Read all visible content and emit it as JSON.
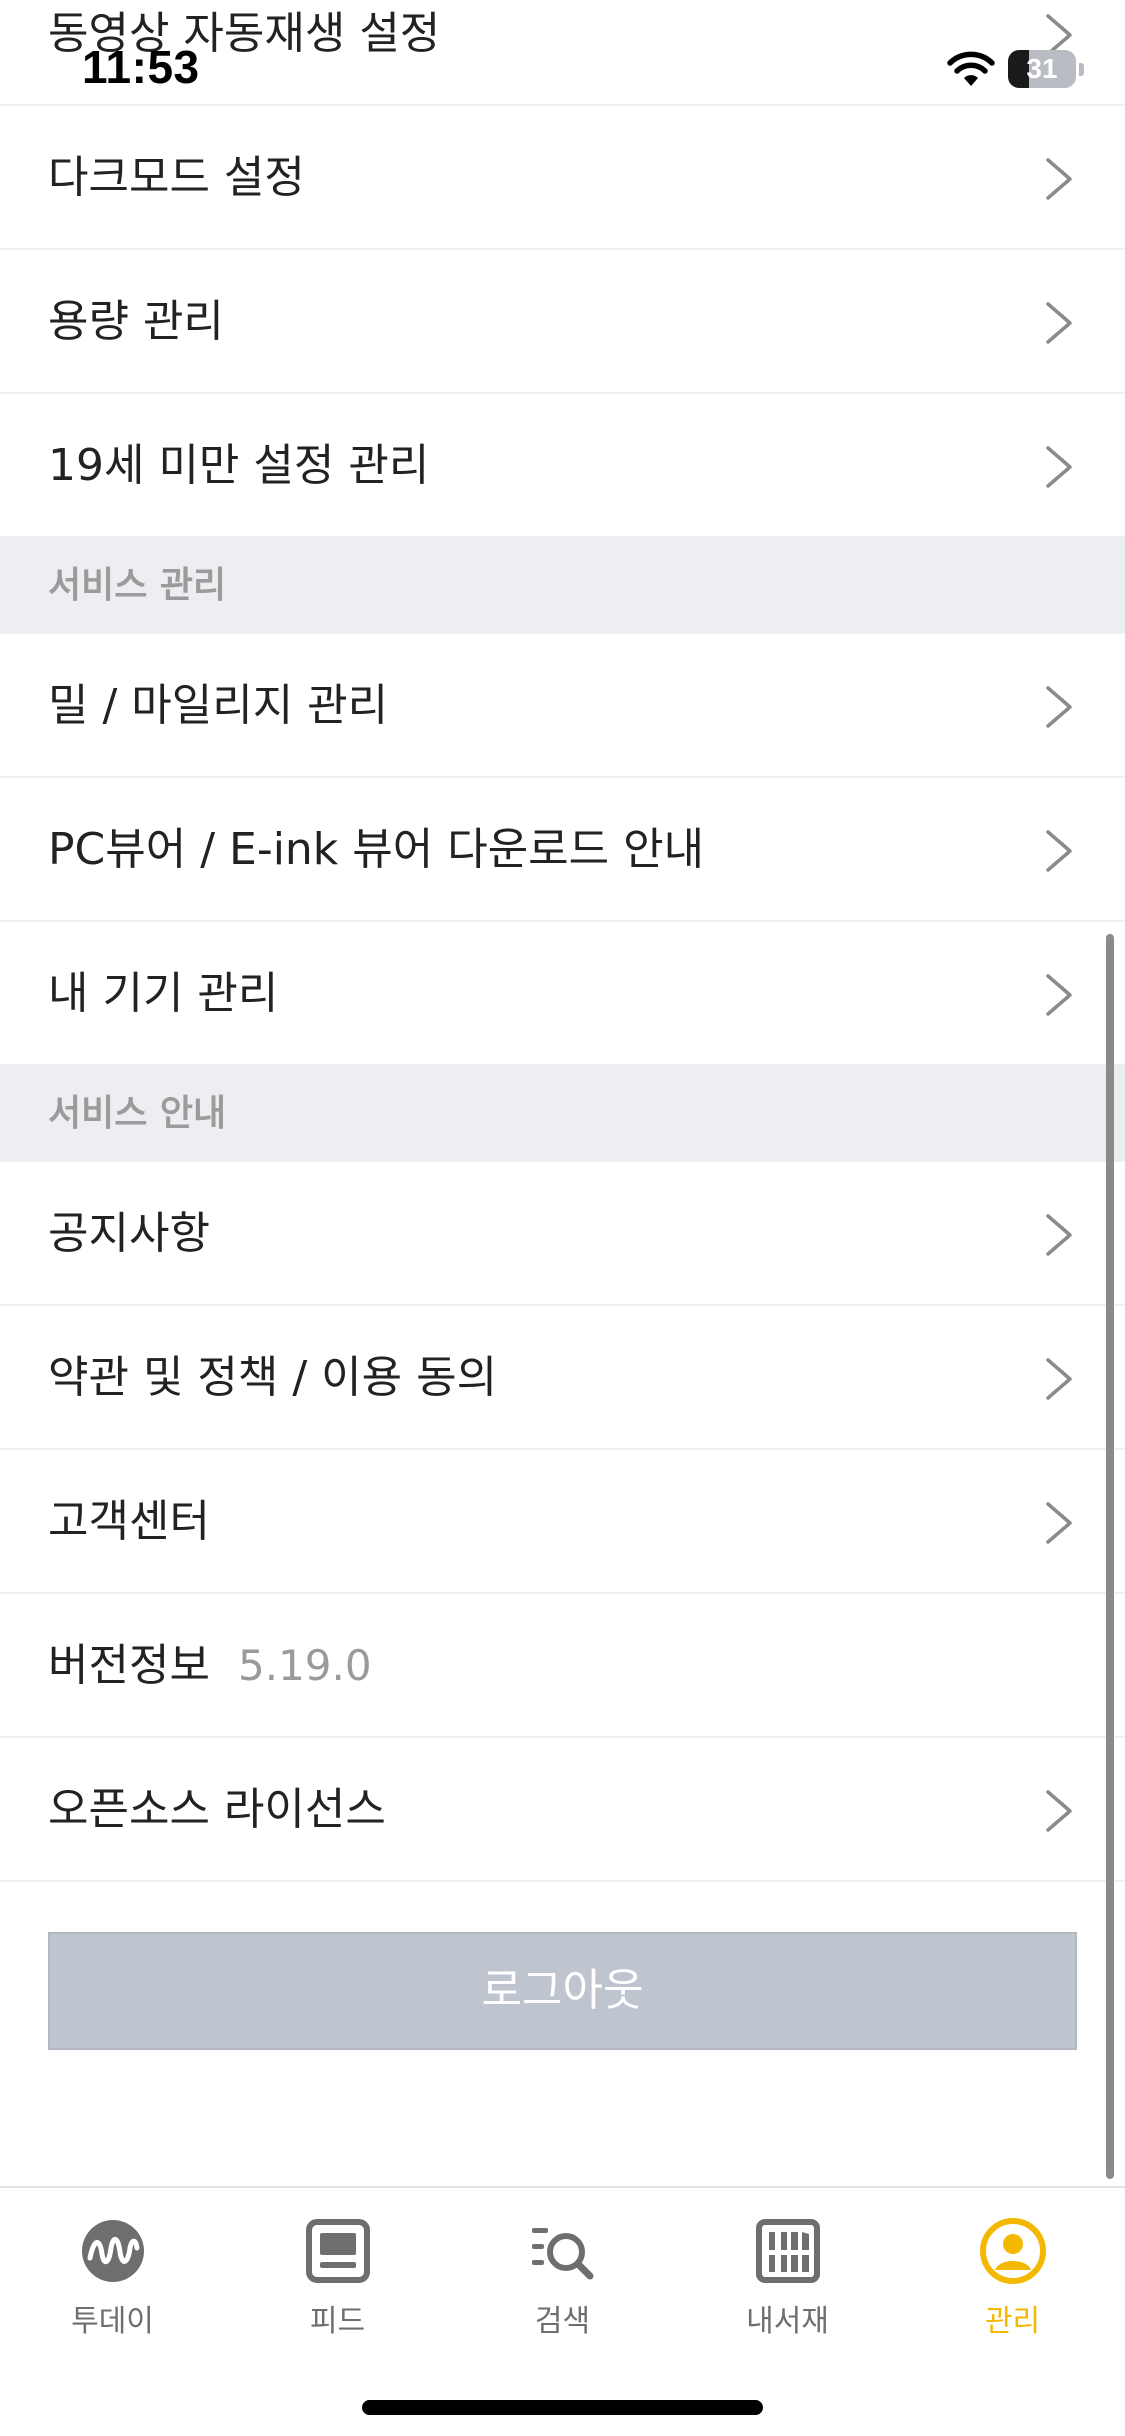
{
  "status_bar": {
    "time": "11:53",
    "battery_level": "31",
    "battery_fraction": 0.31
  },
  "settings": {
    "rows_top": [
      {
        "label": "동영상 자동재생 설정"
      },
      {
        "label": "다크모드 설정"
      },
      {
        "label": "용량 관리"
      },
      {
        "label": "19세 미만 설정 관리"
      }
    ],
    "section_service_manage": {
      "title": "서비스 관리",
      "rows": [
        {
          "label": "밀 / 마일리지 관리"
        },
        {
          "label": "PC뷰어 / E-ink 뷰어 다운로드 안내"
        },
        {
          "label": "내 기기 관리"
        }
      ]
    },
    "section_service_info": {
      "title": "서비스 안내",
      "rows": [
        {
          "label": "공지사항"
        },
        {
          "label": "약관 및 정책 / 이용 동의"
        },
        {
          "label": "고객센터"
        }
      ],
      "version": {
        "label": "버전정보",
        "value": "5.19.0"
      },
      "open_source": {
        "label": "오픈소스 라이선스"
      }
    },
    "logout_label": "로그아웃"
  },
  "tab_bar": {
    "active_color": "#f5b800",
    "tabs": [
      {
        "label": "투데이",
        "icon": "today-wave-icon"
      },
      {
        "label": "피드",
        "icon": "feed-screen-icon"
      },
      {
        "label": "검색",
        "icon": "search-list-icon"
      },
      {
        "label": "내서재",
        "icon": "library-shelf-icon"
      },
      {
        "label": "관리",
        "icon": "profile-circle-icon",
        "active": true
      }
    ]
  }
}
